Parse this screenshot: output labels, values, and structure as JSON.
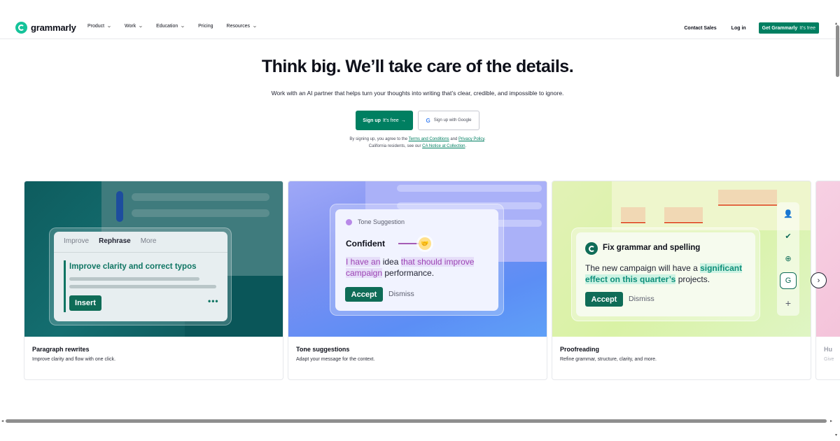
{
  "nav": {
    "logo": "grammarly",
    "menu": [
      {
        "label": "Product",
        "dropdown": true
      },
      {
        "label": "Work",
        "dropdown": true
      },
      {
        "label": "Education",
        "dropdown": true
      },
      {
        "label": "Pricing",
        "dropdown": false
      },
      {
        "label": "Resources",
        "dropdown": true
      }
    ],
    "contact_sales": "Contact Sales",
    "log_in": "Log in",
    "get_grammarly": "Get Grammarly",
    "its_free": "It's free"
  },
  "hero": {
    "headline": "Think big. We’ll take care of the details.",
    "subheadline": "Work with an AI partner that helps turn your thoughts into writing that’s clear, credible, and impossible to ignore.",
    "signup_label": "Sign up",
    "signup_free": "It's free",
    "signup_arrow": "→",
    "google_label": "Sign up with Google",
    "legal_prefix": "By signing up, you agree to the ",
    "terms": "Terms and Conditions",
    "and": " and ",
    "privacy": "Privacy Policy",
    "period": ".",
    "ca_prefix": "California residents, see our ",
    "ca_notice": "CA Notice at Collection",
    "ca_suffix": "."
  },
  "cards": [
    {
      "title": "Paragraph rewrites",
      "description": "Improve clarity and flow with one click.",
      "tabs": [
        "Improve",
        "Rephrase",
        "More"
      ],
      "active_tab": "Rephrase",
      "suggestion": "Improve clarity and correct typos",
      "insert": "Insert",
      "more_dots": "•••"
    },
    {
      "title": "Tone suggestions",
      "description": "Adapt your message for the context.",
      "header": "Tone Suggestion",
      "tone": "Confident",
      "emoji": "🤝",
      "text_a": "I have an",
      "text_b": " idea ",
      "text_c": "that should improve campaign",
      "text_d": " performance.",
      "accept": "Accept",
      "dismiss": "Dismiss"
    },
    {
      "title": "Proofreading",
      "description": "Refine grammar, structure, clarity, and more.",
      "header": "Fix grammar and spelling",
      "text_a": "The new campaign will have a ",
      "text_b": "significant effect on this quarter’s",
      "text_c": " projects.",
      "accept": "Accept",
      "dismiss": "Dismiss"
    },
    {
      "title": "Hu",
      "description": "Give"
    }
  ],
  "colors": {
    "brand_green": "#007f61",
    "accent_mint": "#15c39a"
  }
}
